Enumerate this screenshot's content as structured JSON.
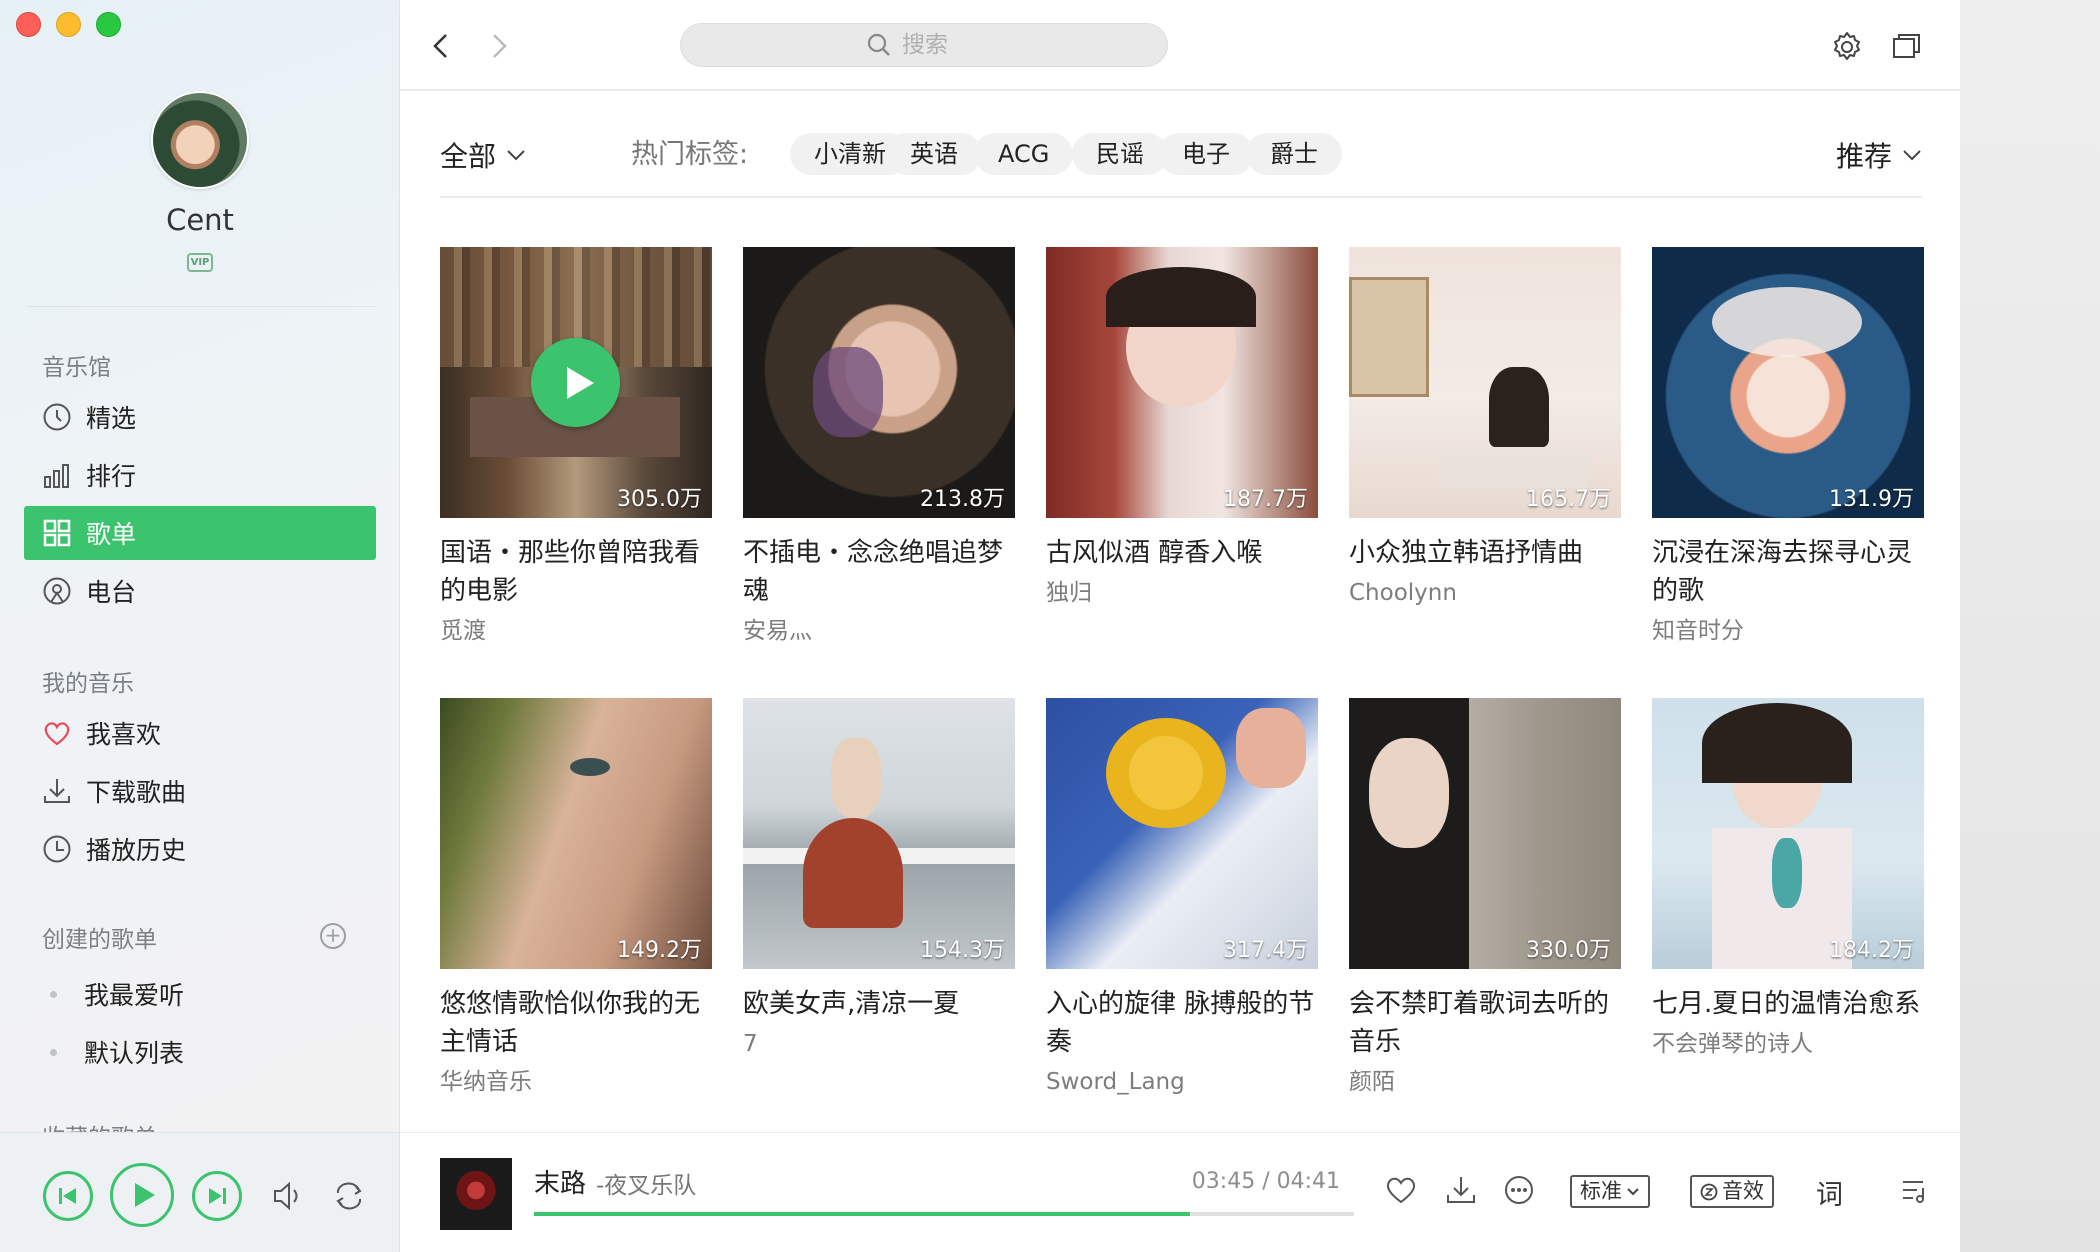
{
  "user": {
    "name": "Cent",
    "badge": "VIP"
  },
  "search": {
    "placeholder": "搜索"
  },
  "sidebar": {
    "music_hall_title": "音乐馆",
    "music_hall": [
      {
        "label": "精选",
        "icon": "featured-icon"
      },
      {
        "label": "排行",
        "icon": "chart-bars-icon"
      },
      {
        "label": "歌单",
        "icon": "grid-icon",
        "active": true
      },
      {
        "label": "电台",
        "icon": "radio-icon"
      }
    ],
    "my_music_title": "我的音乐",
    "my_music": [
      {
        "label": "我喜欢",
        "icon": "heart-icon"
      },
      {
        "label": "下载歌曲",
        "icon": "download-icon"
      },
      {
        "label": "播放历史",
        "icon": "clock-icon"
      }
    ],
    "created_title": "创建的歌单",
    "created": [
      {
        "label": "我最爱听"
      },
      {
        "label": "默认列表"
      }
    ],
    "collected_title": "收藏的歌单"
  },
  "filters": {
    "category": "全部",
    "hot_label": "热门标签:",
    "tags": [
      "小清新",
      "英语",
      "ACG",
      "民谣",
      "电子",
      "爵士"
    ],
    "sort": "推荐"
  },
  "playlists": [
    {
      "title": "国语・那些你曾陪我看的电影",
      "author": "觅渡",
      "count": "305.0万"
    },
    {
      "title": "不插电・念念绝唱追梦魂",
      "author": "安易灬",
      "count": "213.8万"
    },
    {
      "title": "古风似酒 醇香入喉",
      "author": "独归",
      "count": "187.7万"
    },
    {
      "title": "小众独立韩语抒情曲",
      "author": "Choolynn",
      "count": "165.7万"
    },
    {
      "title": "沉浸在深海去探寻心灵的歌",
      "author": "知音时分",
      "count": "131.9万"
    },
    {
      "title": "悠悠情歌恰似你我的无主情话",
      "author": "华纳音乐",
      "count": "149.2万"
    },
    {
      "title": "欧美女声,清凉一夏",
      "author": "7",
      "count": "154.3万"
    },
    {
      "title": "入心的旋律 脉搏般的节奏",
      "author": "Sword_Lang",
      "count": "317.4万"
    },
    {
      "title": "会不禁盯着歌词去听的音乐",
      "author": "颜陌",
      "count": "330.0万"
    },
    {
      "title": "七月.夏日的温情治愈系",
      "author": "不会弹琴的诗人",
      "count": "184.2万"
    }
  ],
  "player": {
    "song": "末路",
    "artist": "-夜叉乐队",
    "time": "03:45 / 04:41",
    "progress": 0.8,
    "quality": "标准",
    "effect": "音效",
    "lyric": "词"
  },
  "colors": {
    "accent": "#3cc36e"
  }
}
